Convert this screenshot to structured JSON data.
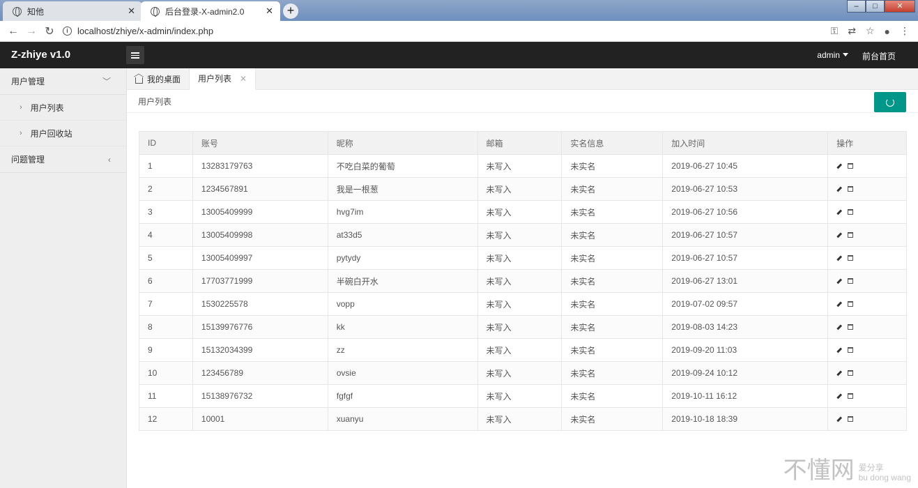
{
  "browser": {
    "tabs": [
      {
        "title": "知他",
        "active": false
      },
      {
        "title": "后台登录-X-admin2.0",
        "active": true
      }
    ],
    "new_tab": "+",
    "url": "localhost/zhiye/x-admin/index.php"
  },
  "header": {
    "logo": "Z-zhiye v1.0",
    "user": "admin",
    "frontpage": "前台首页"
  },
  "sidebar": {
    "groups": [
      {
        "label": "用户管理",
        "arrow": "﹀",
        "items": [
          "用户列表",
          "用户回收站"
        ]
      },
      {
        "label": "问题管理",
        "arrow": "‹",
        "items": []
      }
    ]
  },
  "page_tabs": [
    {
      "label": "我的桌面"
    },
    {
      "label": "用户列表"
    }
  ],
  "breadcrumb": "用户列表",
  "table": {
    "columns": [
      "ID",
      "账号",
      "昵称",
      "邮箱",
      "实名信息",
      "加入时间",
      "操作"
    ],
    "rows": [
      {
        "id": "1",
        "account": "13283179763",
        "nickname": "不吃白菜的葡萄",
        "email": "未写入",
        "realname": "未实名",
        "joined": "2019-06-27 10:45"
      },
      {
        "id": "2",
        "account": "1234567891",
        "nickname": "我是一根葱",
        "email": "未写入",
        "realname": "未实名",
        "joined": "2019-06-27 10:53"
      },
      {
        "id": "3",
        "account": "13005409999",
        "nickname": "hvg7im",
        "email": "未写入",
        "realname": "未实名",
        "joined": "2019-06-27 10:56"
      },
      {
        "id": "4",
        "account": "13005409998",
        "nickname": "at33d5",
        "email": "未写入",
        "realname": "未实名",
        "joined": "2019-06-27 10:57"
      },
      {
        "id": "5",
        "account": "13005409997",
        "nickname": "pytydy",
        "email": "未写入",
        "realname": "未实名",
        "joined": "2019-06-27 10:57"
      },
      {
        "id": "6",
        "account": "17703771999",
        "nickname": "半碗白开水",
        "email": "未写入",
        "realname": "未实名",
        "joined": "2019-06-27 13:01"
      },
      {
        "id": "7",
        "account": "1530225578",
        "nickname": "vopp",
        "email": "未写入",
        "realname": "未实名",
        "joined": "2019-07-02 09:57"
      },
      {
        "id": "8",
        "account": "15139976776",
        "nickname": "kk",
        "email": "未写入",
        "realname": "未实名",
        "joined": "2019-08-03 14:23"
      },
      {
        "id": "9",
        "account": "15132034399",
        "nickname": "zz",
        "email": "未写入",
        "realname": "未实名",
        "joined": "2019-09-20 11:03"
      },
      {
        "id": "10",
        "account": "123456789",
        "nickname": "ovsie",
        "email": "未写入",
        "realname": "未实名",
        "joined": "2019-09-24 10:12"
      },
      {
        "id": "11",
        "account": "15138976732",
        "nickname": "fgfgf",
        "email": "未写入",
        "realname": "未实名",
        "joined": "2019-10-11 16:12"
      },
      {
        "id": "12",
        "account": "10001",
        "nickname": "xuanyu",
        "email": "未写入",
        "realname": "未实名",
        "joined": "2019-10-18 18:39"
      }
    ]
  },
  "watermark": {
    "big": "不懂网",
    "small_top": "爱分享",
    "small_bottom": "bu dong wang"
  },
  "colors": {
    "header_bg": "#222222",
    "accent": "#009688",
    "sidebar_bg": "#eeeeee"
  },
  "icons": {
    "edit": "pencil-icon",
    "delete": "trash-icon",
    "refresh": "refresh-icon",
    "home": "home-icon"
  }
}
